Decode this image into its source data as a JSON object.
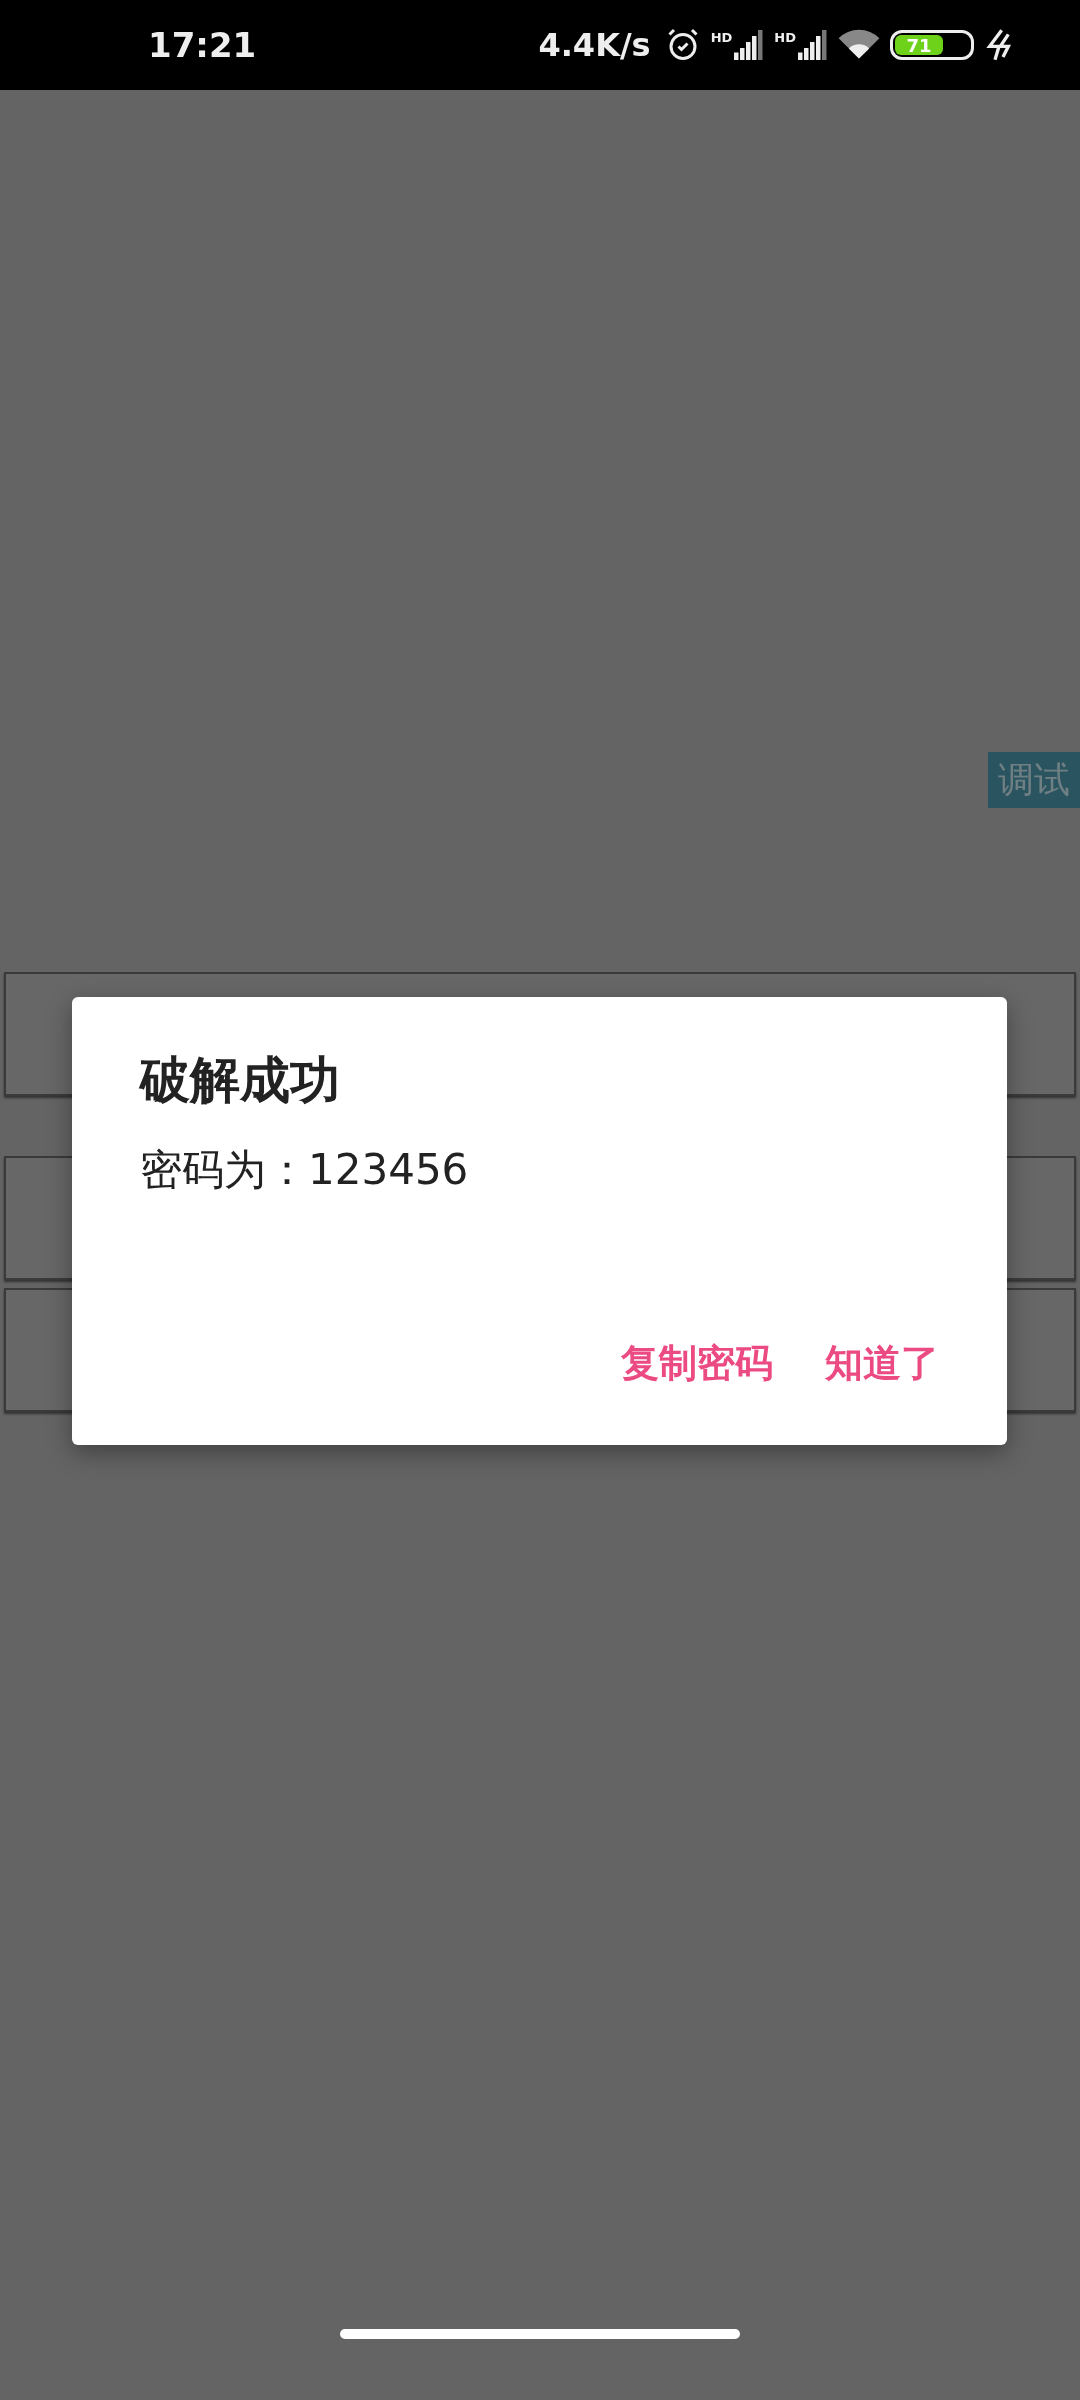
{
  "status_bar": {
    "time": "17:21",
    "net_speed": "4.4K/s",
    "signals": [
      {
        "label": "HD"
      },
      {
        "label": "HD"
      }
    ],
    "battery": "71"
  },
  "debug_tab": {
    "label": "调试"
  },
  "background": {
    "buttons": [
      {
        "kind": "blank"
      },
      {
        "kind": "blank"
      },
      {
        "kind": "blank"
      }
    ]
  },
  "dialog": {
    "title": "破解成功",
    "message": "密码为：123456",
    "buttons": [
      {
        "label": "复制密码"
      },
      {
        "label": "知道了"
      }
    ]
  }
}
